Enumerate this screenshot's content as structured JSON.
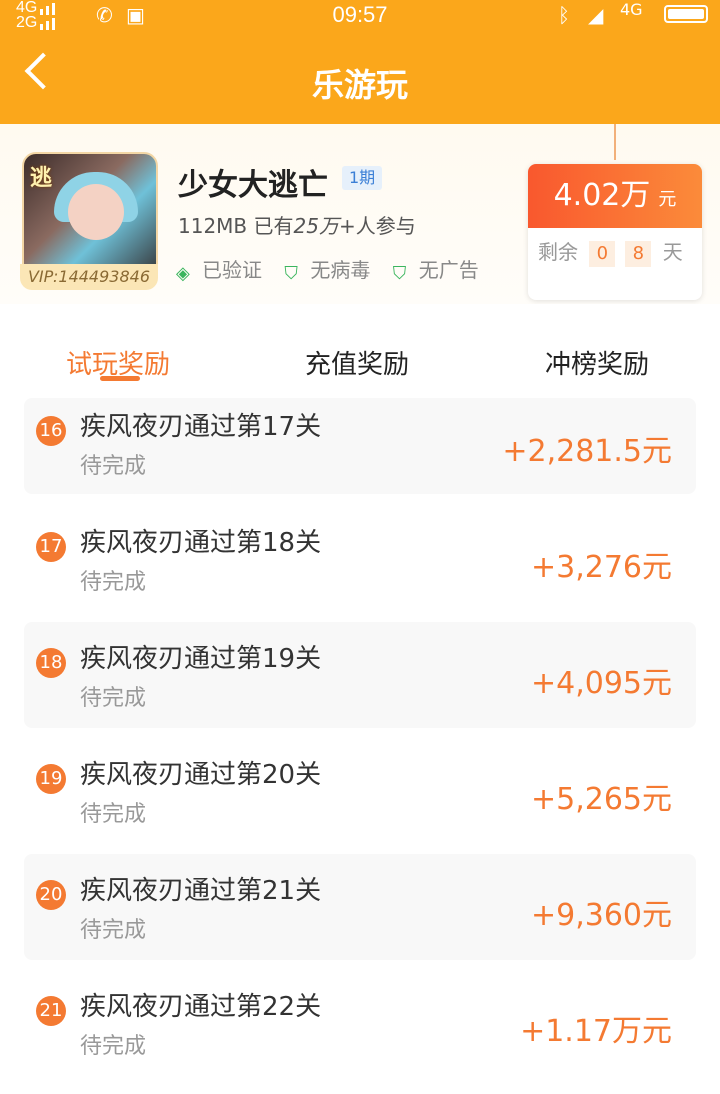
{
  "status": {
    "sig1": "4G",
    "sig2": "2G",
    "time": "09:57",
    "sig_right": "4G"
  },
  "nav": {
    "title": "乐游玩"
  },
  "game": {
    "name": "少女大逃亡",
    "period": "1期",
    "size": "112MB",
    "participants_prefix": "已有",
    "participants": "25万+",
    "participants_suffix": "人参与",
    "vip": "VIP:144493846",
    "badges": [
      "已验证",
      "无病毒",
      "无广告"
    ],
    "reward_amount": "4.02万",
    "reward_unit": "元",
    "remain_label": "剩余",
    "remain_digits": [
      "0",
      "8"
    ],
    "remain_unit": "天"
  },
  "tabs": [
    "试玩奖励",
    "充值奖励",
    "冲榜奖励"
  ],
  "tasks": [
    {
      "no": "16",
      "title": "疾风夜刃通过第17关",
      "status": "待完成",
      "amount": "+2,281.5元"
    },
    {
      "no": "17",
      "title": "疾风夜刃通过第18关",
      "status": "待完成",
      "amount": "+3,276元"
    },
    {
      "no": "18",
      "title": "疾风夜刃通过第19关",
      "status": "待完成",
      "amount": "+4,095元"
    },
    {
      "no": "19",
      "title": "疾风夜刃通过第20关",
      "status": "待完成",
      "amount": "+5,265元"
    },
    {
      "no": "20",
      "title": "疾风夜刃通过第21关",
      "status": "待完成",
      "amount": "+9,360元"
    },
    {
      "no": "21",
      "title": "疾风夜刃通过第22关",
      "status": "待完成",
      "amount": "+1.17万元"
    }
  ]
}
